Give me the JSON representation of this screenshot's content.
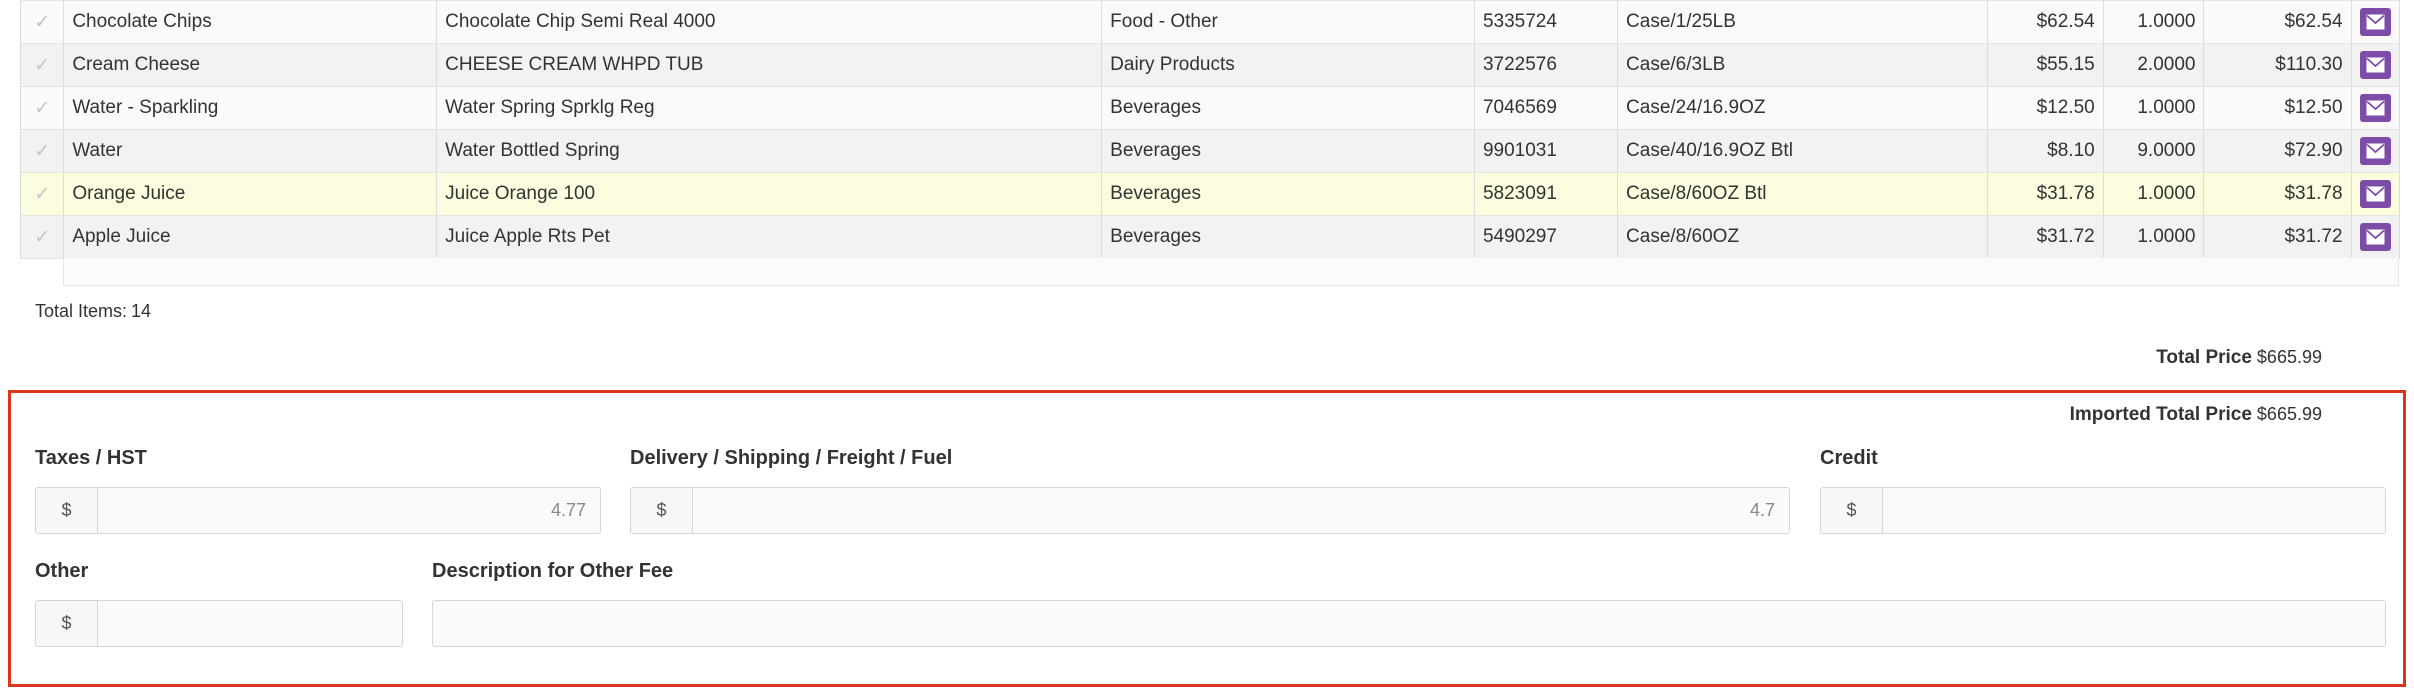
{
  "table": {
    "rows": [
      {
        "name": "Chocolate Chips",
        "description": "Chocolate Chip Semi Real 4000",
        "category": "Food - Other",
        "code": "5335724",
        "pack": "Case/1/25LB",
        "unit_price": "$62.54",
        "qty": "1.0000",
        "total": "$62.54",
        "highlighted": false
      },
      {
        "name": "Cream Cheese",
        "description": "CHEESE CREAM WHPD TUB",
        "category": "Dairy Products",
        "code": "3722576",
        "pack": "Case/6/3LB",
        "unit_price": "$55.15",
        "qty": "2.0000",
        "total": "$110.30",
        "highlighted": false
      },
      {
        "name": "Water - Sparkling",
        "description": "Water Spring Sprklg Reg",
        "category": "Beverages",
        "code": "7046569",
        "pack": "Case/24/16.9OZ",
        "unit_price": "$12.50",
        "qty": "1.0000",
        "total": "$12.50",
        "highlighted": false
      },
      {
        "name": "Water",
        "description": "Water Bottled Spring",
        "category": "Beverages",
        "code": "9901031",
        "pack": "Case/40/16.9OZ Btl",
        "unit_price": "$8.10",
        "qty": "9.0000",
        "total": "$72.90",
        "highlighted": false
      },
      {
        "name": "Orange Juice",
        "description": "Juice Orange 100",
        "category": "Beverages",
        "code": "5823091",
        "pack": "Case/8/60OZ Btl",
        "unit_price": "$31.78",
        "qty": "1.0000",
        "total": "$31.78",
        "highlighted": true
      },
      {
        "name": "Apple Juice",
        "description": "Juice Apple Rts Pet",
        "category": "Beverages",
        "code": "5490297",
        "pack": "Case/8/60OZ",
        "unit_price": "$31.72",
        "qty": "1.0000",
        "total": "$31.72",
        "highlighted": false
      }
    ],
    "check_glyph": "✓",
    "action_icon": "mail-icon"
  },
  "summary": {
    "total_items_label": "Total Items:",
    "total_items_value": "14",
    "total_price_label": "Total Price",
    "total_price_value": "$665.99",
    "imported_total_label": "Imported Total Price",
    "imported_total_value": "$665.99"
  },
  "fees": {
    "taxes": {
      "label": "Taxes / HST",
      "addon": "$",
      "value": "4.77"
    },
    "delivery": {
      "label": "Delivery / Shipping / Freight / Fuel",
      "addon": "$",
      "value": "4.7"
    },
    "credit": {
      "label": "Credit",
      "addon": "$",
      "value": ""
    },
    "other": {
      "label": "Other",
      "addon": "$",
      "value": ""
    },
    "other_description": {
      "label": "Description for Other Fee",
      "value": ""
    }
  },
  "colors": {
    "accent_purple": "#7d4ca6",
    "highlight_border": "#d9351f",
    "highlight_row": "#fcfcdf"
  }
}
